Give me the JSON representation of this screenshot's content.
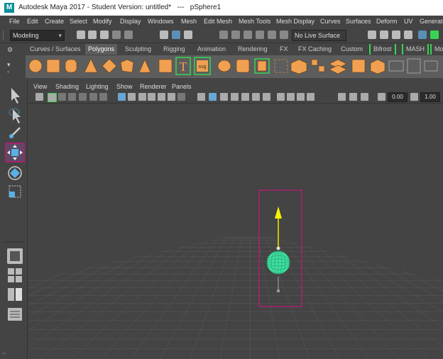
{
  "window": {
    "logo_letter": "M",
    "title": "Autodesk Maya 2017 - Student Version: untitled*   ---   pSphere1"
  },
  "menu": [
    "File",
    "Edit",
    "Create",
    "Select",
    "Modify",
    "Display",
    "Windows",
    "Mesh",
    "Edit Mesh",
    "Mesh Tools",
    "Mesh Display",
    "Curves",
    "Surfaces",
    "Deform",
    "UV",
    "Generate"
  ],
  "status": {
    "mode": "Modeling",
    "live_surface": "No Live Surface"
  },
  "shelf_tabs": [
    "Curves / Surfaces",
    "Polygons",
    "Sculpting",
    "Rigging",
    "Animation",
    "Rendering",
    "FX",
    "FX Caching",
    "Custom",
    "Bifrost",
    "MASH",
    "Mo"
  ],
  "active_shelf_tab": "Polygons",
  "shelf_icons": [
    "poly-sphere-icon",
    "poly-cube-icon",
    "poly-cylinder-icon",
    "poly-cone-icon",
    "poly-torus-icon",
    "poly-plane-icon",
    "poly-disc-icon",
    "poly-pyramid-icon",
    "type-icon",
    "svg-icon",
    "combine-icon",
    "separate-icon",
    "smooth-icon",
    "boolean-icon",
    "extrude-icon",
    "bevel-icon",
    "bridge-icon",
    "insert-edgeloop-icon",
    "multicut-icon",
    "merge-icon",
    "uv-editor-icon",
    "planar-mapping-icon",
    "automatic-mapping-icon"
  ],
  "shelf_icon_labels": {
    "type": "T",
    "svg": "svg"
  },
  "panel_menu": [
    "View",
    "Shading",
    "Lighting",
    "Show",
    "Renderer",
    "Panels"
  ],
  "panel_fields": {
    "field1": "0.00",
    "field2": "1.00"
  },
  "colors": {
    "accent_orange": "#f0a050",
    "selection_magenta": "#c2187a",
    "sphere_green": "#3fe0a0",
    "manip_yellow": "#f5f500",
    "highlight_blue": "#5a8fb8"
  }
}
